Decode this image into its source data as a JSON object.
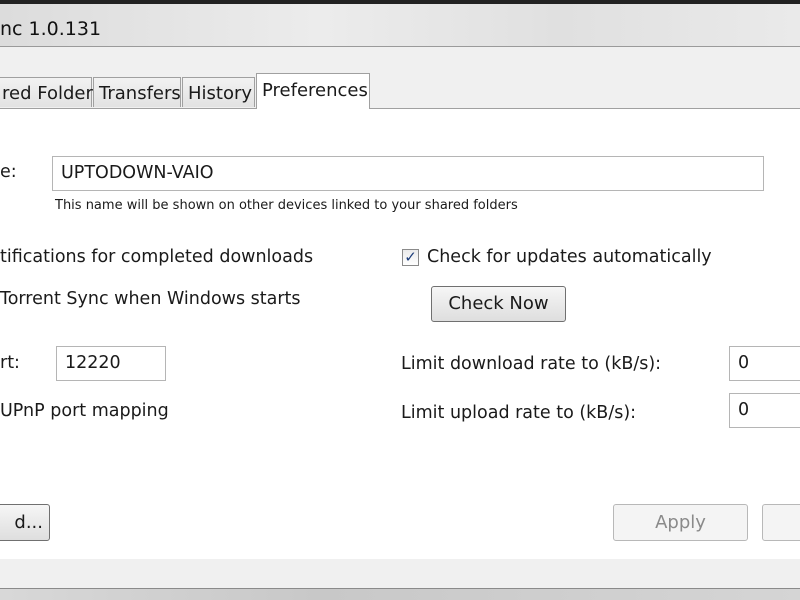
{
  "window": {
    "title": "nc 1.0.131"
  },
  "tabs": [
    {
      "label": "red Folders",
      "selected": false
    },
    {
      "label": "Transfers",
      "selected": false
    },
    {
      "label": "History",
      "selected": false
    },
    {
      "label": "Preferences",
      "selected": true
    }
  ],
  "prefs": {
    "device_name_label": "e:",
    "device_name_value": "UPTODOWN-VAIO",
    "device_name_hint": "This name will be shown on other devices linked to your shared folders",
    "notifications_label": "tifications for completed downloads",
    "check_updates_label": "Check for updates automatically",
    "check_updates_checked": true,
    "check_mark": "✓",
    "startup_label": "Torrent Sync when Windows starts",
    "check_now_label": "Check Now",
    "port_label": "rt:",
    "port_value": "12220",
    "download_limit_label": "Limit download rate to (kB/s):",
    "download_limit_value": "0",
    "upnp_label": " UPnP port mapping",
    "upload_limit_label": "Limit upload rate to (kB/s):",
    "upload_limit_value": "0",
    "advanced_label": "d...",
    "apply_label": "Apply"
  }
}
